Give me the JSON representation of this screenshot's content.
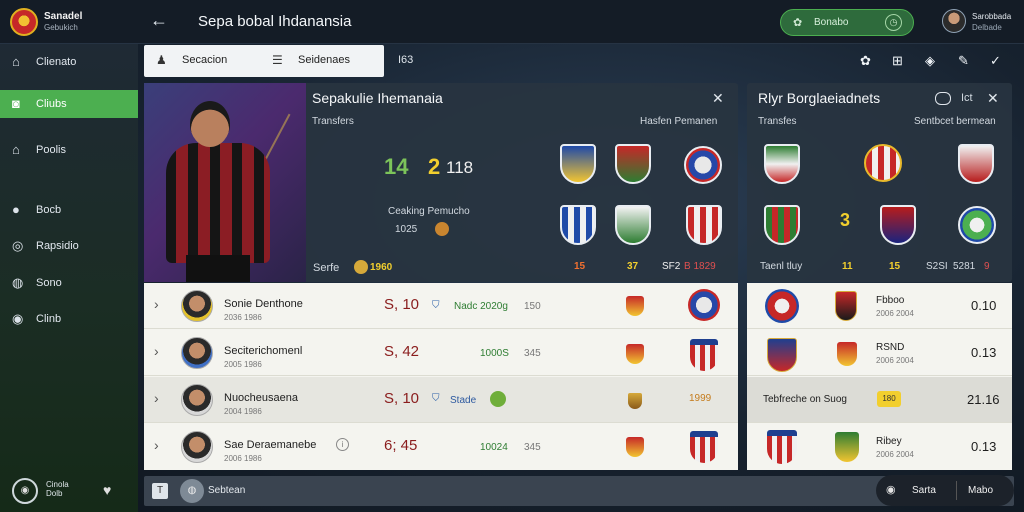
{
  "app": {
    "brand_line1": "Sanadel",
    "brand_line2": "Gebukich",
    "title": "Sepa bobal Ihdanansia",
    "status_label": "Bonabo",
    "user_line1": "Sarobbada",
    "user_line2": "Delbade"
  },
  "sidebar": {
    "items": [
      {
        "icon": "home-icon",
        "glyph": "⌂",
        "label": "Clienato"
      },
      {
        "icon": "club-icon",
        "glyph": "◙",
        "label": "Cliubs"
      },
      {
        "icon": "building-icon",
        "glyph": "⌂",
        "label": "Poolis"
      },
      {
        "icon": "pin-icon",
        "glyph": "●",
        "label": "Bocb"
      },
      {
        "icon": "settings-icon",
        "glyph": "◎",
        "label": "Rapsidio"
      },
      {
        "icon": "ball-icon",
        "glyph": "◍",
        "label": "Sono"
      },
      {
        "icon": "team-icon",
        "glyph": "◉",
        "label": "Clinb"
      }
    ],
    "footer_label": "Cinola Dolb"
  },
  "tabs": {
    "tab1": "Secacion",
    "tab2": "Seidenaes",
    "aux": "I63"
  },
  "main_panel": {
    "title": "Sepakulie Ihemanaia",
    "sub_left": "Transfers",
    "sub_right": "Hasfen Pemanen",
    "num_a": "14",
    "num_b": "2",
    "num_c": "118",
    "mid_label": "Ceaking Pemucho",
    "mid_value": "1025",
    "foot_label": "Serfe",
    "foot_badge": "1960",
    "stat1": "15",
    "stat2": "37",
    "stat3": "SF2",
    "stat4": "B 1829"
  },
  "right_panel": {
    "title": "Rlyr Borglaeiadnets",
    "badge": "Ict",
    "sub_left": "Transfes",
    "sub_right": "Sentbcet bermean",
    "mid_num": "3",
    "foot_label": "Taenl tluy",
    "stat1": "11",
    "stat2": "15",
    "stat3": "S2SI",
    "stat4": "5281",
    "stat5": "9"
  },
  "players": [
    {
      "name": "Sonie Denthone",
      "sub": "2036 1986",
      "price": "S, 10",
      "s1": "Nadc 2020g",
      "s2": "150"
    },
    {
      "name": "Seciterichomenl",
      "sub": "2005 1986",
      "price": "S, 42",
      "s1": "1000S",
      "s2": "345"
    },
    {
      "name": "Nuocheusaena",
      "sub": "2004 1986",
      "price": "S, 10",
      "s1": "Stade",
      "s2": "",
      "rank": "1999"
    },
    {
      "name": "Sae Deraemanebe",
      "sub": "2006 1986",
      "price": "6; 45",
      "s1": "10024",
      "s2": "345"
    }
  ],
  "right_rows": [
    {
      "name": "Fbboo",
      "sub": "2006 2004",
      "value": "0.10"
    },
    {
      "name": "RSND",
      "sub": "2006 2004",
      "value": "0.13"
    },
    {
      "name": "Tebfreche on Suog",
      "sub": "",
      "badge": "180",
      "value": "21.16"
    },
    {
      "name": "Ribey",
      "sub": "2006 2004",
      "value": "0.13"
    }
  ],
  "bottom": {
    "label": "Sebtean",
    "pill_a": "Sarta",
    "pill_b": "Mabo"
  },
  "colors": {
    "accent": "#4caf50",
    "num_green": "#7cc45a",
    "num_yellow": "#f2cf2e",
    "price_red": "#8a1d1d"
  }
}
